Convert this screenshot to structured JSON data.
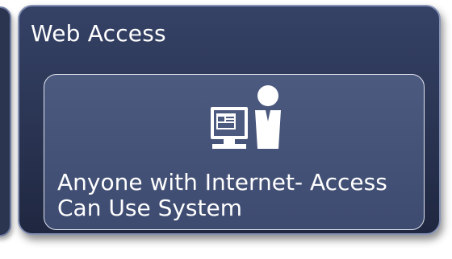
{
  "panel": {
    "title": "Web Access"
  },
  "card": {
    "line1": "Anyone with Internet- Access",
    "line2": "Can Use System"
  },
  "icons": [
    "computer-monitor-icon",
    "person-icon"
  ],
  "colors": {
    "panel_bg": "#2a3452",
    "card_bg": "#4c5a80",
    "text": "#ffffff"
  }
}
